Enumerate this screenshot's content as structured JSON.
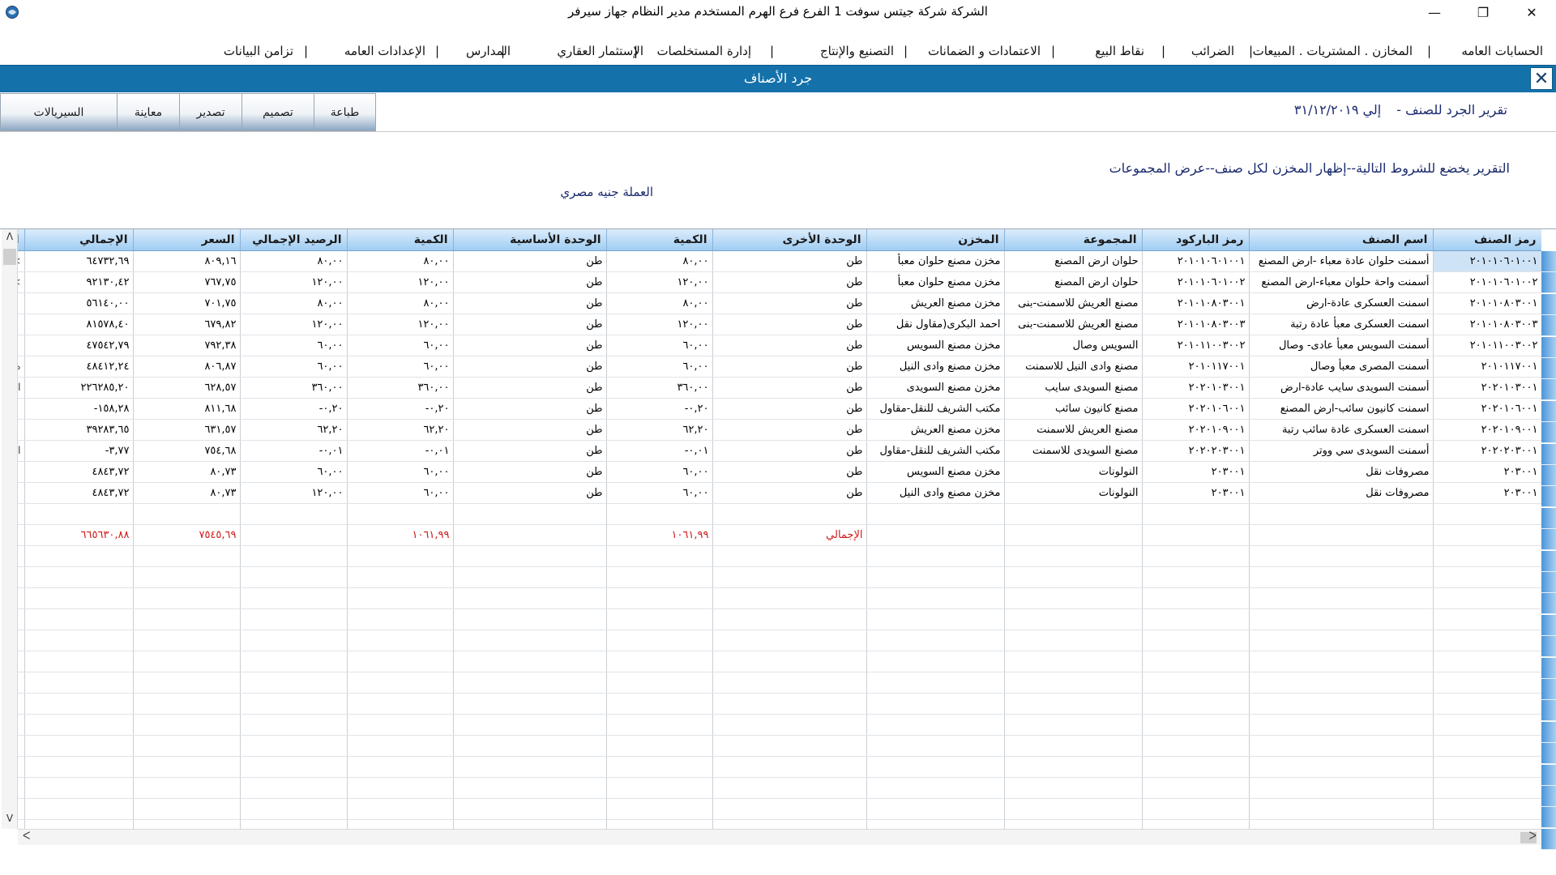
{
  "window": {
    "title": "الشركة شركة جيتس سوفت 1   الفرع فرع الهرم   المستخدم مدير النظام  جهاز سيرفر",
    "minimize_icon": "minimize-icon",
    "maximize_icon": "restore-icon",
    "close_icon": "close-icon"
  },
  "menu": [
    "الحسابات العامه",
    "المخازن . المشتريات . المبيعات",
    "الضرائب",
    "نقاط البيع",
    "الاعتمادات و الضمانات",
    "التصنيع والإنتاج",
    "إدارة المستخلصات",
    "الإستثمار العقاري",
    "المدارس",
    "الإعدادات العامه",
    "تزامن البيانات"
  ],
  "form": {
    "title": "جرد الأصناف",
    "close_label": "✕"
  },
  "toolbar": {
    "print": "طباعة",
    "design": "تصميم",
    "export": "تصدير",
    "preview": "معاينة",
    "serials": "السيريالات"
  },
  "report": {
    "period_prefix": "تقرير الجرد للصنف -",
    "period_to": "إلي ٣١/١٢/٢٠١٩",
    "conditions": "التقرير يخضع للشروط التالية--إظهار المخزن لكل صنف--عرض المجموعات",
    "currency": "العملة جنيه مصري"
  },
  "columns": [
    "رمز الصنف",
    "اسم الصنف",
    "رمز الباركود",
    "المجموعة",
    "المخزن",
    "الوحدة الأخرى",
    "الكمية",
    "الوحدة الأساسية",
    "الكمية",
    "الرصيد الإجمالي",
    "السعر",
    "الإجمالي",
    "ال"
  ],
  "rows": [
    [
      "٢٠١٠١٠٦٠١٠٠١",
      "أسمنت حلوان عادة معباء -ارض المصنع",
      "٢٠١٠١٠٦٠١٠٠١",
      "حلوان ارض المصنع",
      "مخزن مصنع حلوان معبأ",
      "طن",
      "٨٠,٠٠",
      "طن",
      "٨٠,٠٠",
      "٨٠,٠٠",
      "٨٠٩,١٦",
      "٦٤٧٣٢,٦٩",
      ">"
    ],
    [
      "٢٠١٠١٠٦٠١٠٠٢",
      "أسمنت واحة حلوان معباء-ارض المصنع",
      "٢٠١٠١٠٦٠١٠٠٢",
      "حلوان ارض المصنع",
      "مخزن مصنع حلوان معبأ",
      "طن",
      "١٢٠,٠٠",
      "طن",
      "١٢٠,٠٠",
      "١٢٠,٠٠",
      "٧٦٧,٧٥",
      "٩٢١٣٠,٤٢",
      ">"
    ],
    [
      "٢٠١٠١٠٨٠٣٠٠١",
      "اسمنت العسكرى عادة-ارض",
      "٢٠١٠١٠٨٠٣٠٠١",
      "مصنع العريش للاسمنت-بنى",
      "مخزن مصنع العريش",
      "طن",
      "٨٠,٠٠",
      "طن",
      "٨٠,٠٠",
      "٨٠,٠٠",
      "٧٠١,٧٥",
      "٥٦١٤٠,٠٠",
      ""
    ],
    [
      "٢٠١٠١٠٨٠٣٠٠٣",
      "اسمنت العسكرى معبأ عادة رتبة",
      "٢٠١٠١٠٨٠٣٠٠٣",
      "مصنع العريش للاسمنت-بنى",
      "احمد البكرى(مقاول نقل",
      "طن",
      "١٢٠,٠٠",
      "طن",
      "١٢٠,٠٠",
      "١٢٠,٠٠",
      "٦٧٩,٨٢",
      "٨١٥٧٨,٤٠",
      ""
    ],
    [
      "٢٠١٠١١٠٠٣٠٠٢",
      "أسمنت السويس معبأ عادى- وصال",
      "٢٠١٠١١٠٠٣٠٠٢",
      "السويس وصال",
      "مخزن مصنع السويس",
      "طن",
      "٦٠,٠٠",
      "طن",
      "٦٠,٠٠",
      "٦٠,٠٠",
      "٧٩٢,٣٨",
      "٤٧٥٤٢,٧٩",
      ""
    ],
    [
      "٢٠١٠١١٧٠٠١",
      "أسمنت المصرى معبأ وصال",
      "٢٠١٠١١٧٠٠١",
      "مصنع وادى النيل للاسمنت",
      "مخزن مصنع وادى النيل",
      "طن",
      "٦٠,٠٠",
      "طن",
      "٦٠,٠٠",
      "٦٠,٠٠",
      "٨٠٦,٨٧",
      "٤٨٤١٢,٢٤",
      "ه"
    ],
    [
      "٢٠٢٠١٠٣٠٠١",
      "أسمنت السويدى سايب عادة-ارض",
      "٢٠٢٠١٠٣٠٠١",
      "مصنع السويدى سايب",
      "مخزن مصنع السويدى",
      "طن",
      "٣٦٠,٠٠",
      "طن",
      "٣٦٠,٠٠",
      "٣٦٠,٠٠",
      "٦٢٨,٥٧",
      "٢٢٦٢٨٥,٢٠",
      "ll"
    ],
    [
      "٢٠٢٠١٠٦٠٠١",
      "اسمنت كانيون سائب-ارض المصنع",
      "٢٠٢٠١٠٦٠٠١",
      "مصنع كانيون سائب",
      "مكتب الشريف للنقل-مقاول",
      "طن",
      "٠,٢٠-",
      "طن",
      "٠,٢٠-",
      "٠,٢٠-",
      "٨١١,٦٨",
      "١٥٨,٢٨-",
      ""
    ],
    [
      "٢٠٢٠١٠٩٠٠١",
      "اسمنت العسكرى عادة سائب رتبة",
      "٢٠٢٠١٠٩٠٠١",
      "مصنع العريش للاسمنت",
      "مخزن مصنع العريش",
      "طن",
      "٦٢,٢٠",
      "طن",
      "٦٢,٢٠",
      "٦٢,٢٠",
      "٦٣١,٥٧",
      "٣٩٢٨٣,٦٥",
      ""
    ],
    [
      "٢٠٢٠٢٠٣٠٠١",
      "أسمنت السويدى سي ووتر",
      "٢٠٢٠٢٠٣٠٠١",
      "مصنع السويدى للاسمنت",
      "مكتب الشريف للنقل-مقاول",
      "طن",
      "٠,٠١-",
      "طن",
      "٠,٠١-",
      "٠,٠١-",
      "٧٥٤,٦٨",
      "٣,٧٧-",
      "ll"
    ],
    [
      "٢٠٣٠٠١",
      "مصروفات نقل",
      "٢٠٣٠٠١",
      "النولونات",
      "مخزن مصنع السويس",
      "طن",
      "٦٠,٠٠",
      "طن",
      "٦٠,٠٠",
      "٦٠,٠٠",
      "٨٠,٧٣",
      "٤٨٤٣,٧٢",
      ""
    ],
    [
      "٢٠٣٠٠١",
      "مصروفات نقل",
      "٢٠٣٠٠١",
      "النولونات",
      "مخزن مصنع وادى النيل",
      "طن",
      "٦٠,٠٠",
      "طن",
      "٦٠,٠٠",
      "١٢٠,٠٠",
      "٨٠,٧٣",
      "٤٨٤٣,٧٢",
      ""
    ]
  ],
  "totals": {
    "label": "الإجمالي",
    "qty_other": "١٠٦١,٩٩",
    "qty_base": "١٠٦١,٩٩",
    "price": "٧٥٤٥,٦٩",
    "total": "٦٦٥٦٣٠,٨٨"
  },
  "colors": {
    "header_blue": "#1471aa",
    "total_red": "#d01818",
    "text_navy": "#1a2a6e"
  }
}
